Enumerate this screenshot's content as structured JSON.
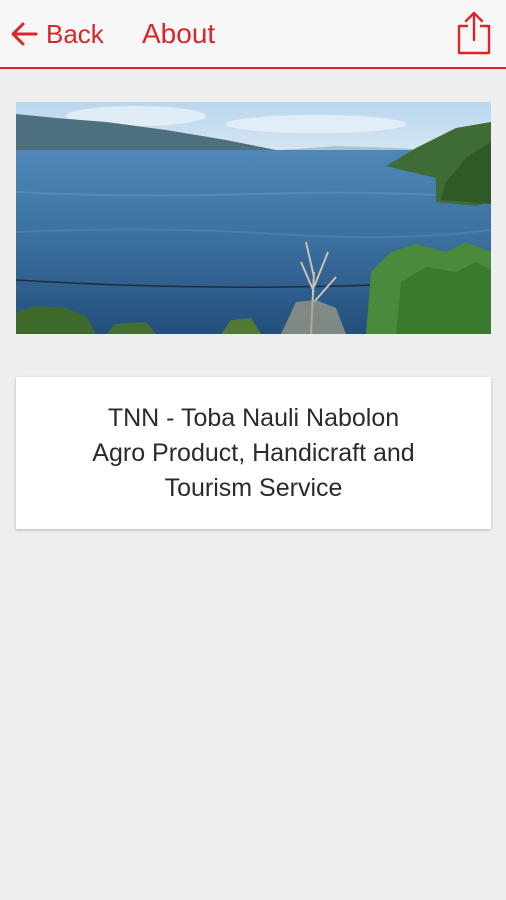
{
  "header": {
    "back_label": "Back",
    "title": "About",
    "back_icon": "arrow-left-icon",
    "share_icon": "share-icon"
  },
  "hero": {
    "scene": "lake-landscape"
  },
  "card": {
    "lines": [
      "TNN - Toba Nauli Nabolon",
      "Agro Product, Handicraft and",
      "Tourism Service"
    ]
  },
  "colors": {
    "accent": "#d9262b",
    "background": "#eeeeee",
    "header_bg": "#f7f7f7",
    "card_bg": "#ffffff",
    "text": "#2b2b2b"
  }
}
